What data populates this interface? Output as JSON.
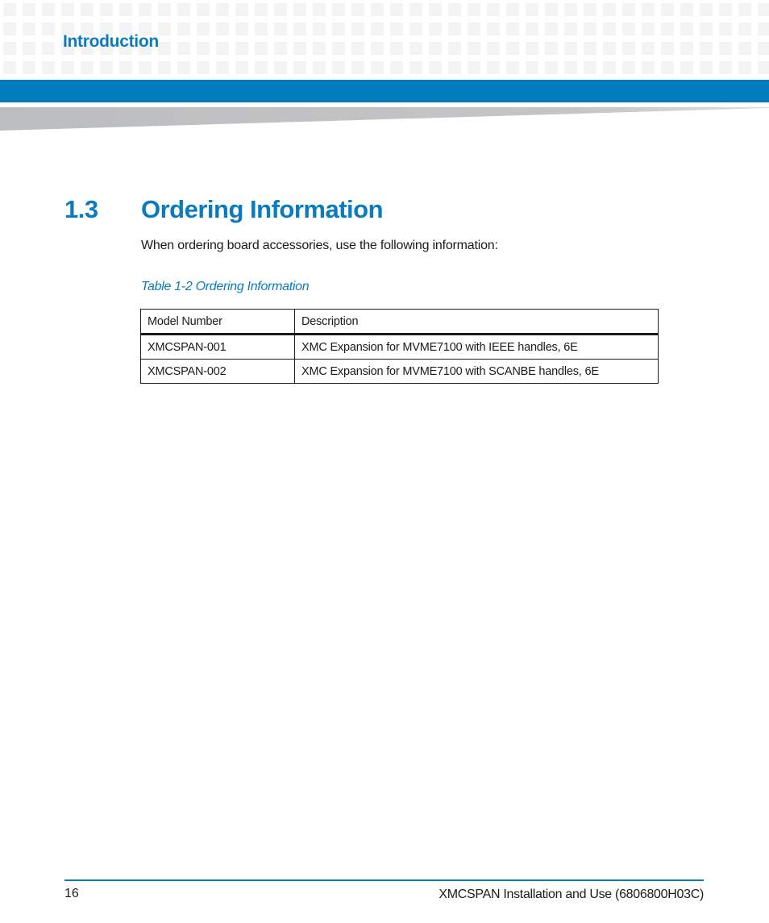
{
  "header": {
    "chapter_title": "Introduction",
    "accent_color": "#007dbd"
  },
  "section": {
    "number": "1.3",
    "title": "Ordering Information",
    "intro": "When ordering board accessories, use the following information:"
  },
  "table": {
    "caption": "Table 1-2 Ordering Information",
    "columns": [
      "Model Number",
      "Description"
    ],
    "rows": [
      [
        "XMCSPAN-001",
        "XMC Expansion for MVME7100 with IEEE handles, 6E"
      ],
      [
        "XMCSPAN-002",
        "XMC Expansion for MVME7100 with SCANBE handles, 6E"
      ]
    ]
  },
  "footer": {
    "page_number": "16",
    "document_title": "XMCSPAN Installation and Use (6806800H03C)"
  }
}
